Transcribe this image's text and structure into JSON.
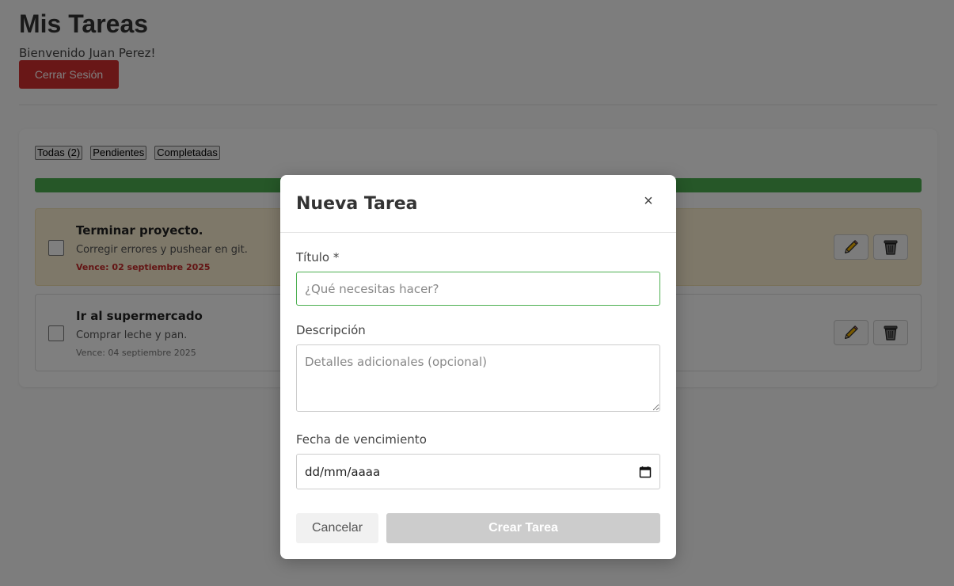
{
  "header": {
    "title": "Mis Tareas",
    "welcome": "Bienvenido Juan Perez!",
    "logout_label": "Cerrar Sesión"
  },
  "filters": [
    {
      "label": "Todas (2)"
    },
    {
      "label": "Pendientes"
    },
    {
      "label": "Completadas"
    }
  ],
  "progress": {
    "value": 1.0,
    "color": "#4caf50"
  },
  "tasks": [
    {
      "title": "Terminar proyecto.",
      "description": "Corregir errores y pushear en git.",
      "due": "Vence: 02 septiembre 2025",
      "overdue": true,
      "completed": false
    },
    {
      "title": "Ir al supermercado",
      "description": "Comprar leche y pan.",
      "due": "Vence: 04 septiembre 2025",
      "overdue": false,
      "completed": false
    }
  ],
  "modal": {
    "title": "Nueva Tarea",
    "close_symbol": "×",
    "title_label": "Título *",
    "title_value": "",
    "title_placeholder": "¿Qué necesitas hacer?",
    "description_label": "Descripción",
    "description_value": "",
    "description_placeholder": "Detalles adicionales (opcional)",
    "date_label": "Fecha de vencimiento",
    "date_placeholder": "dd/mm/aaaa",
    "cancel_label": "Cancelar",
    "create_label": "Crear Tarea"
  },
  "colors": {
    "logout": "#d32f2f",
    "progress": "#4caf50",
    "overdue_bg": "#fdf1d3",
    "overdue_text": "#c62828",
    "create_disabled": "#cccccc"
  },
  "icons": {
    "edit": "pencil-icon",
    "delete": "trash-icon",
    "calendar": "calendar-icon",
    "close": "close-icon"
  }
}
